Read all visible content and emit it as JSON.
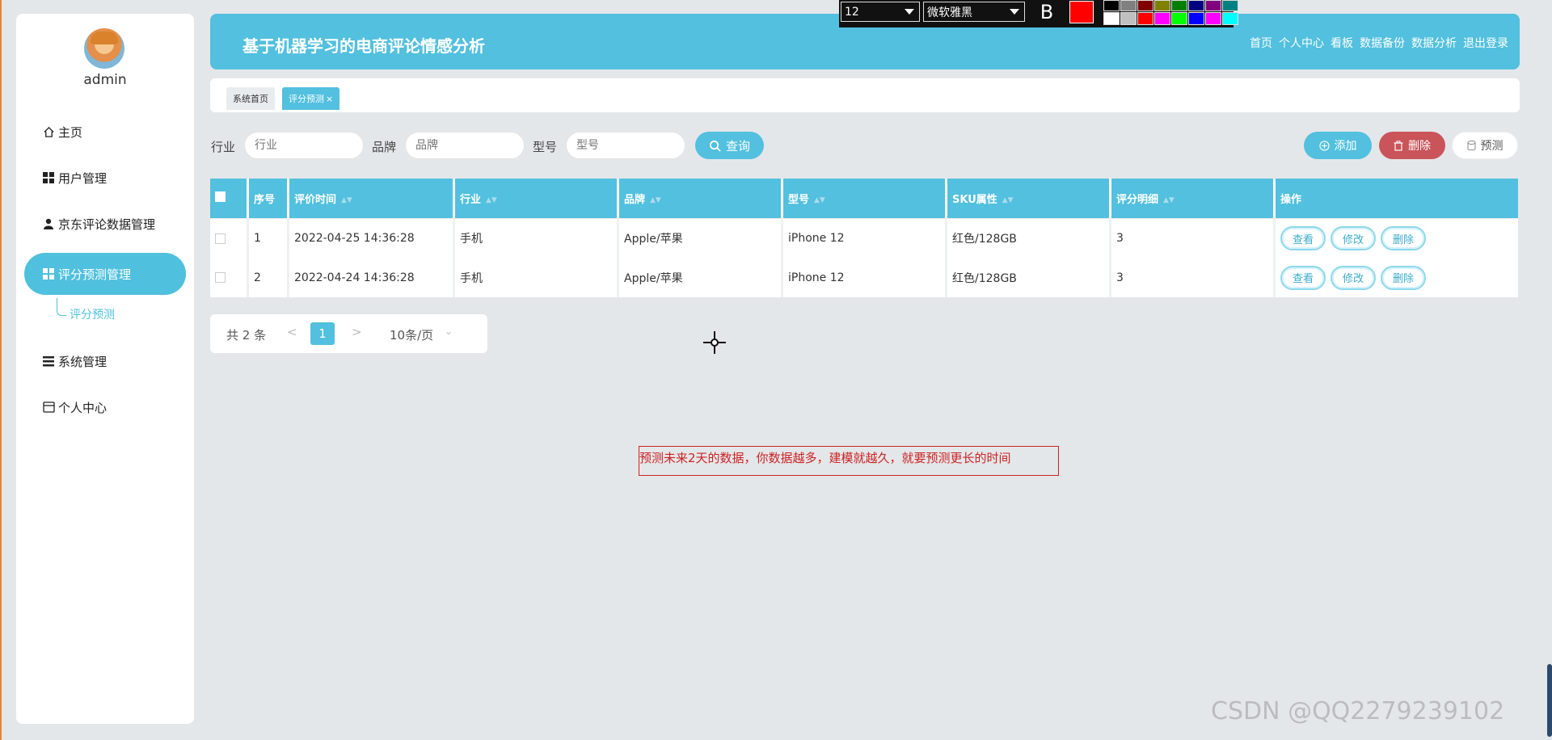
{
  "sidebar": {
    "username": "admin",
    "items": [
      {
        "label": "主页",
        "icon": "home-icon"
      },
      {
        "label": "用户管理",
        "icon": "grid-icon"
      },
      {
        "label": "京东评论数据管理",
        "icon": "user-icon"
      },
      {
        "label": "评分预测管理",
        "icon": "grid-icon",
        "active": true
      },
      {
        "label": "系统管理",
        "icon": "list-icon"
      },
      {
        "label": "个人中心",
        "icon": "card-icon"
      }
    ],
    "sub_item": "评分预测"
  },
  "header": {
    "title": "基于机器学习的电商评论情感分析",
    "nav": [
      "首页",
      "个人中心",
      "看板",
      "数据备份",
      "数据分析",
      "退出登录"
    ]
  },
  "annot_toolbar": {
    "font_size": "12",
    "font_name": "微软雅黑",
    "bold": "B",
    "current_color": "#ff0000",
    "palette": [
      "#000000",
      "#808080",
      "#800000",
      "#808000",
      "#008000",
      "#000080",
      "#800080",
      "#008080",
      "#ffffff",
      "#c0c0c0",
      "#ff0000",
      "#ff00ff",
      "#00ff00",
      "#0000ff",
      "#ff00ff",
      "#00ffff"
    ]
  },
  "tabs": {
    "home": "系统首页",
    "current": "评分预测"
  },
  "search": {
    "industry_label": "行业",
    "industry_placeholder": "行业",
    "brand_label": "品牌",
    "brand_placeholder": "品牌",
    "model_label": "型号",
    "model_placeholder": "型号",
    "query": "查询",
    "add": "添加",
    "delete": "删除",
    "predict": "预测"
  },
  "table": {
    "columns": [
      "序号",
      "评价时间",
      "行业",
      "品牌",
      "型号",
      "SKU属性",
      "评分明细",
      "操作"
    ],
    "rows": [
      {
        "idx": "1",
        "time": "2022-04-25 14:36:28",
        "industry": "手机",
        "brand": "Apple/苹果",
        "model": "iPhone 12",
        "sku": "红色/128GB",
        "score": "3"
      },
      {
        "idx": "2",
        "time": "2022-04-24 14:36:28",
        "industry": "手机",
        "brand": "Apple/苹果",
        "model": "iPhone 12",
        "sku": "红色/128GB",
        "score": "3"
      }
    ],
    "ops": {
      "view": "查看",
      "edit": "修改",
      "delete": "删除"
    }
  },
  "pager": {
    "total": "共 2 条",
    "prev": "<",
    "page": "1",
    "next": ">",
    "size": "10条/页",
    "size_arrow": "⌄"
  },
  "note": "预测未来2天的数据，你数据越多，建模就越久，就要预测更长的时间",
  "watermark": "CSDN @QQ2279239102"
}
